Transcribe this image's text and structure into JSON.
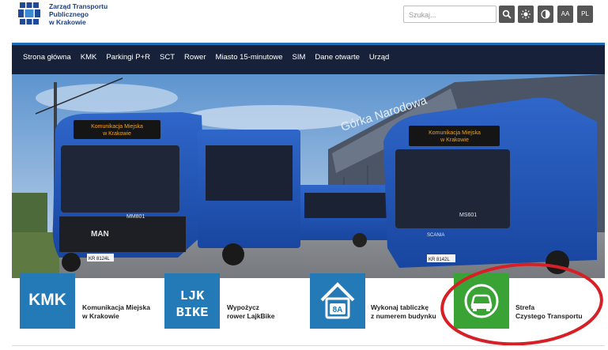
{
  "header": {
    "logo_lines": [
      "Zarząd Transportu",
      "Publicznego",
      "w Krakowie"
    ],
    "search_placeholder": "Szukaj...",
    "font_size_label": "AA",
    "language_label": "PL"
  },
  "nav": {
    "items": [
      "Strona główna",
      "KMK",
      "Parkingi P+R",
      "SCT",
      "Rower",
      "Miasto 15-minutowe",
      "SIM",
      "Dane otwarte",
      "Urząd"
    ]
  },
  "hero": {
    "building_sign": "Górka Narodowa",
    "bus_left_display": [
      "Komunikacja Miejska",
      "w Krakowie"
    ],
    "bus_right_display": [
      "Komunikacja Miejska",
      "w Krakowie"
    ],
    "bus_left_number": "MM801",
    "bus_right_number": "MS601",
    "bus_left_brand": "MAN",
    "bus_right_brand": "SCANIA",
    "bus_left_plate": "KR 8124L",
    "bus_right_plate": "KR 8142L"
  },
  "tiles": [
    {
      "icon_text": "KMK",
      "lines": [
        "Komunikacja Miejska",
        "w Krakowie"
      ],
      "color": "#2479b7"
    },
    {
      "icon_text": "LajkBike",
      "lines": [
        "Wypożycz",
        "rower LajkBike"
      ],
      "color": "#2479b7"
    },
    {
      "icon_text": "8A",
      "lines": [
        "Wykonaj tabliczkę",
        "z numerem budynku"
      ],
      "color": "#2479b7"
    },
    {
      "icon_text": "car",
      "lines": [
        "Strefa",
        "Czystego Transportu"
      ],
      "color": "#3aa335"
    }
  ],
  "annotation": {
    "color": "#d61f26"
  }
}
